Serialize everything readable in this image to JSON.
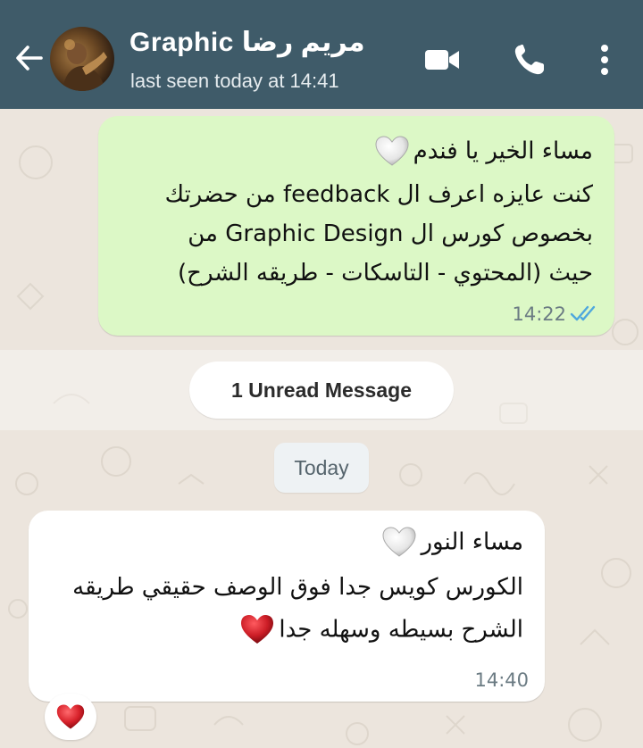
{
  "header": {
    "contact_name": "Graphic مريم رضا",
    "status": "last seen today at 14:41",
    "icons": [
      "back-arrow-icon",
      "video-call-icon",
      "voice-call-icon",
      "more-options-icon"
    ],
    "background_color": "#3f5b69"
  },
  "messages": [
    {
      "direction": "outgoing",
      "lines": [
        "مساء الخير يا فندم",
        "كنت عايزه اعرف ال feedback من حضرتك",
        "بخصوص كورس ال Graphic Design من",
        "حيث (المحتوي - التاسكات - طريقه الشرح)"
      ],
      "time": "14:22",
      "read_ticks": "double-blue-tick-icon",
      "bubble_color": "#dcf8c6"
    },
    {
      "direction": "incoming",
      "lines": [
        "مساء النور",
        "الكورس كويس جدا فوق الوصف حقيقي طريقه",
        "الشرح بسيطه وسهله جدا"
      ],
      "time": "14:40",
      "reaction": "❤️",
      "bubble_color": "#ffffff"
    }
  ],
  "unread_label": "1 Unread Message",
  "date_label": "Today",
  "colors": {
    "chat_background": "#ece5dd",
    "tick_blue": "#4fa8dd",
    "heart_red": "#cc1d26"
  }
}
